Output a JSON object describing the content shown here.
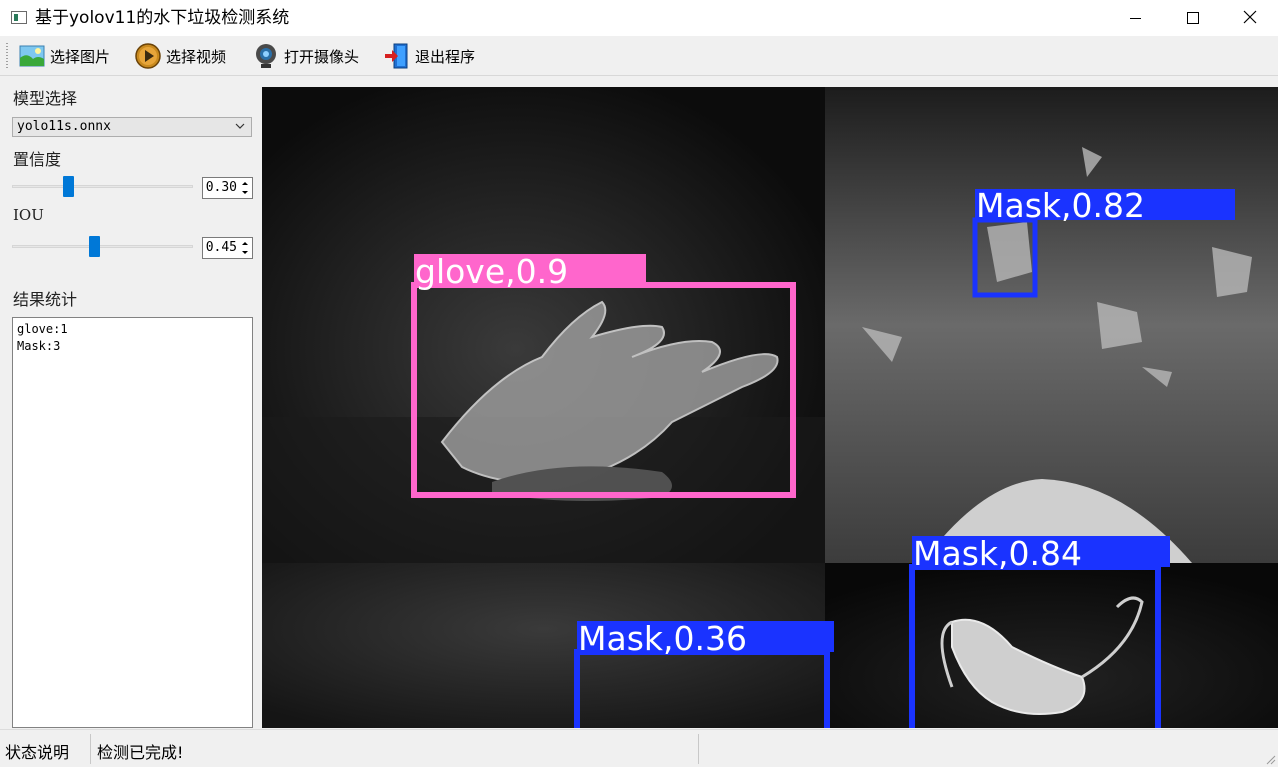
{
  "window": {
    "title": "基于yolov11的水下垃圾检测系统",
    "buttons": [
      "minimize-icon",
      "maximize-icon",
      "close-icon"
    ]
  },
  "toolbar": {
    "items": [
      {
        "label": "选择图片",
        "icon": "image-icon"
      },
      {
        "label": "选择视频",
        "icon": "play-video-icon"
      },
      {
        "label": "打开摄像头",
        "icon": "webcam-icon"
      },
      {
        "label": "退出程序",
        "icon": "exit-door-icon"
      }
    ]
  },
  "sidebar": {
    "model_label": "模型选择",
    "model_value": "yolo11s.onnx",
    "confidence_label": "置信度",
    "confidence_value": "0.30",
    "confidence_fraction": 0.3,
    "iou_label": "IOU",
    "iou_value": "0.45",
    "iou_fraction": 0.45,
    "stats_label": "结果统计",
    "stats_lines": [
      "glove:1",
      "Mask:3"
    ]
  },
  "detections": [
    {
      "label": "glove,0.9",
      "class": "glove",
      "confidence": 0.9,
      "color": "#ff66cc"
    },
    {
      "label": "Mask,0.82",
      "class": "Mask",
      "confidence": 0.82,
      "color": "#1a33ff"
    },
    {
      "label": "Mask,0.84",
      "class": "Mask",
      "confidence": 0.84,
      "color": "#1a33ff"
    },
    {
      "label": "Mask,0.36",
      "class": "Mask",
      "confidence": 0.36,
      "color": "#1a33ff"
    }
  ],
  "status": {
    "caption": "状态说明",
    "message": "检测已完成!"
  }
}
